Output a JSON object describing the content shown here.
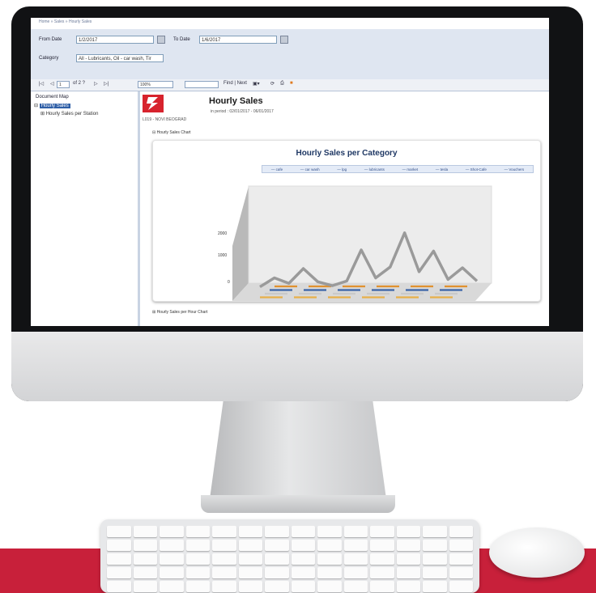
{
  "screen": {
    "breadcrumb": "Home » Sales » Hourly Sales",
    "params": {
      "from_label": "From Date",
      "from_value": "1/2/2017",
      "to_label": "To Date",
      "to_value": "1/6/2017",
      "category_label": "Category",
      "category_value": "All - Lubricants, Oil - car wash, Tir"
    },
    "toolbar": {
      "first": "|◁",
      "prev": "◁",
      "page": "1",
      "of_pages": "of 2 ?",
      "next": "▷",
      "last": "▷|",
      "zoom": "100%",
      "find": "Find | Next"
    },
    "docmap": {
      "title": "Document Map",
      "items": [
        {
          "label": "Hourly Sales",
          "toggle": "⊟"
        },
        {
          "label": "Hourly Sales per Station",
          "toggle": "⊞"
        }
      ]
    },
    "report": {
      "title": "Hourly Sales",
      "period": "in period : 02/01/2017 - 06/01/2017",
      "station": "L019 - NOVI BEOGRAD",
      "section1": "⊟ Hourly Sales Chart",
      "section2": "⊞ Hourly Sales per Hour Chart"
    }
  },
  "chart_data": {
    "type": "area",
    "title": "Hourly Sales per Category",
    "series": [
      {
        "name": "cafe",
        "color": "#9a9a9a",
        "values": [
          30,
          260,
          120,
          500,
          160,
          60,
          180,
          980,
          260,
          540,
          1420,
          420,
          950,
          220,
          520,
          180
        ]
      },
      {
        "name": "car wash",
        "color": "#e0912f"
      },
      {
        "name": "lpg",
        "color": "#3a63a8"
      },
      {
        "name": "lubricants",
        "color": "#c9c9c9"
      },
      {
        "name": "market",
        "color": "#e8b04a"
      },
      {
        "name": "tesla"
      },
      {
        "name": "Shot-Cafe"
      },
      {
        "name": "Vouchers"
      }
    ],
    "ylabel": "",
    "yticks": [
      "0",
      "1000",
      "2000"
    ],
    "ylim": [
      0,
      2500
    ]
  }
}
